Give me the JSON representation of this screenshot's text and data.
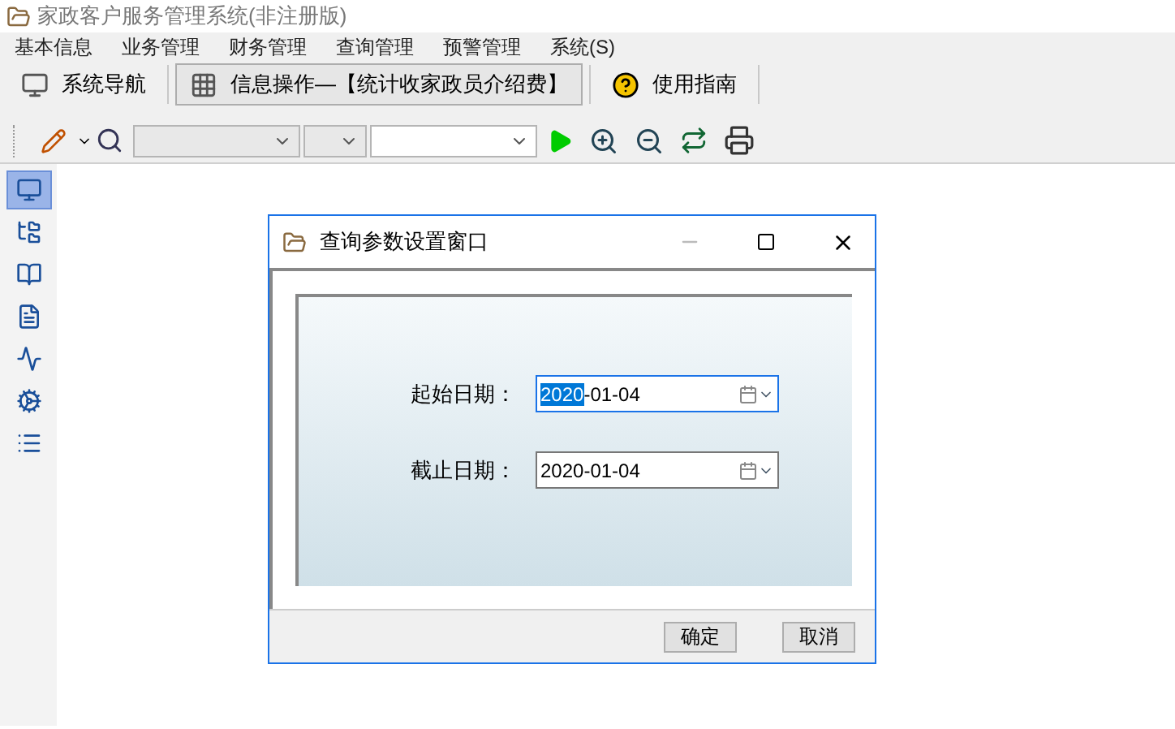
{
  "window": {
    "title": "家政客户服务管理系统(非注册版)"
  },
  "menu": [
    "基本信息",
    "业务管理",
    "财务管理",
    "查询管理",
    "预警管理",
    "系统(S)"
  ],
  "tabs": [
    {
      "label": "系统导航",
      "selected": false,
      "kind": "monitor"
    },
    {
      "label": "信息操作—【统计收家政员介绍费】",
      "selected": true,
      "kind": "grid"
    },
    {
      "label": "使用指南",
      "selected": false,
      "kind": "help"
    }
  ],
  "sidebar": {
    "items": [
      {
        "kind": "monitor",
        "selected": true
      },
      {
        "kind": "tree",
        "selected": false
      },
      {
        "kind": "book",
        "selected": false
      },
      {
        "kind": "doc",
        "selected": false
      },
      {
        "kind": "chart",
        "selected": false
      },
      {
        "kind": "settings",
        "selected": false
      },
      {
        "kind": "list",
        "selected": false
      }
    ]
  },
  "dialog": {
    "title": "查询参数设置窗口",
    "fields": [
      {
        "label": "起始日期：",
        "value": "2020-01-04",
        "focused": true
      },
      {
        "label": "截止日期：",
        "value": "2020-01-04",
        "focused": false
      }
    ],
    "buttons": [
      "确定",
      "取消"
    ]
  }
}
